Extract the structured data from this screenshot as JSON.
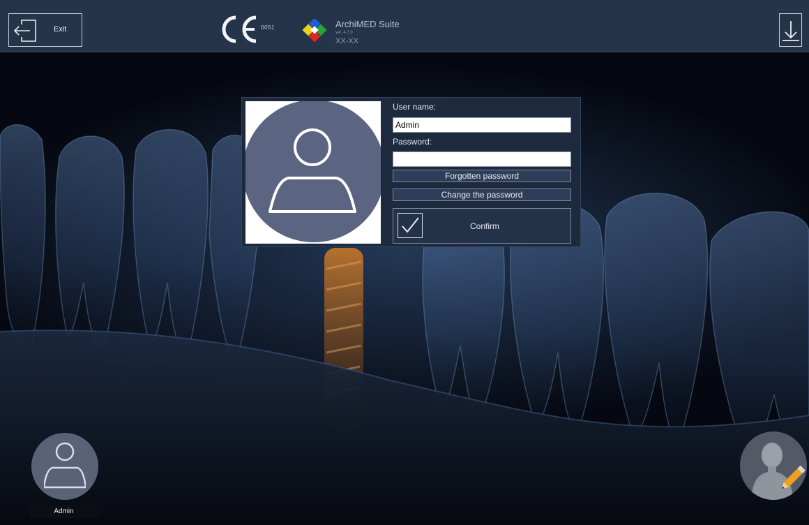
{
  "topbar": {
    "exit_label": "Exit",
    "ce_number": "0051",
    "app_title": "ArchiMED Suite",
    "app_version": "ver. 4.7.0",
    "app_code": "XX-XX"
  },
  "login": {
    "username_label": "User name:",
    "username_value": "Admin",
    "password_label": "Password:",
    "password_value": "",
    "forgotten_label": "Forgotten password",
    "change_label": "Change the password",
    "confirm_label": "Confirm"
  },
  "bottom": {
    "user_name": "Admin"
  },
  "icons": {
    "exit": "exit-door-icon",
    "download": "download-arrow-icon",
    "ce": "ce-mark-icon",
    "logo": "archimed-diamond-logo",
    "avatar": "user-silhouette-icon",
    "confirm": "checkmark-icon",
    "edit_user": "user-edit-pencil-icon"
  },
  "colors": {
    "topbar": "#26344a",
    "panel": "#1d2a3e",
    "avatar_circle": "#5b6582",
    "implant": "#c8782a"
  }
}
